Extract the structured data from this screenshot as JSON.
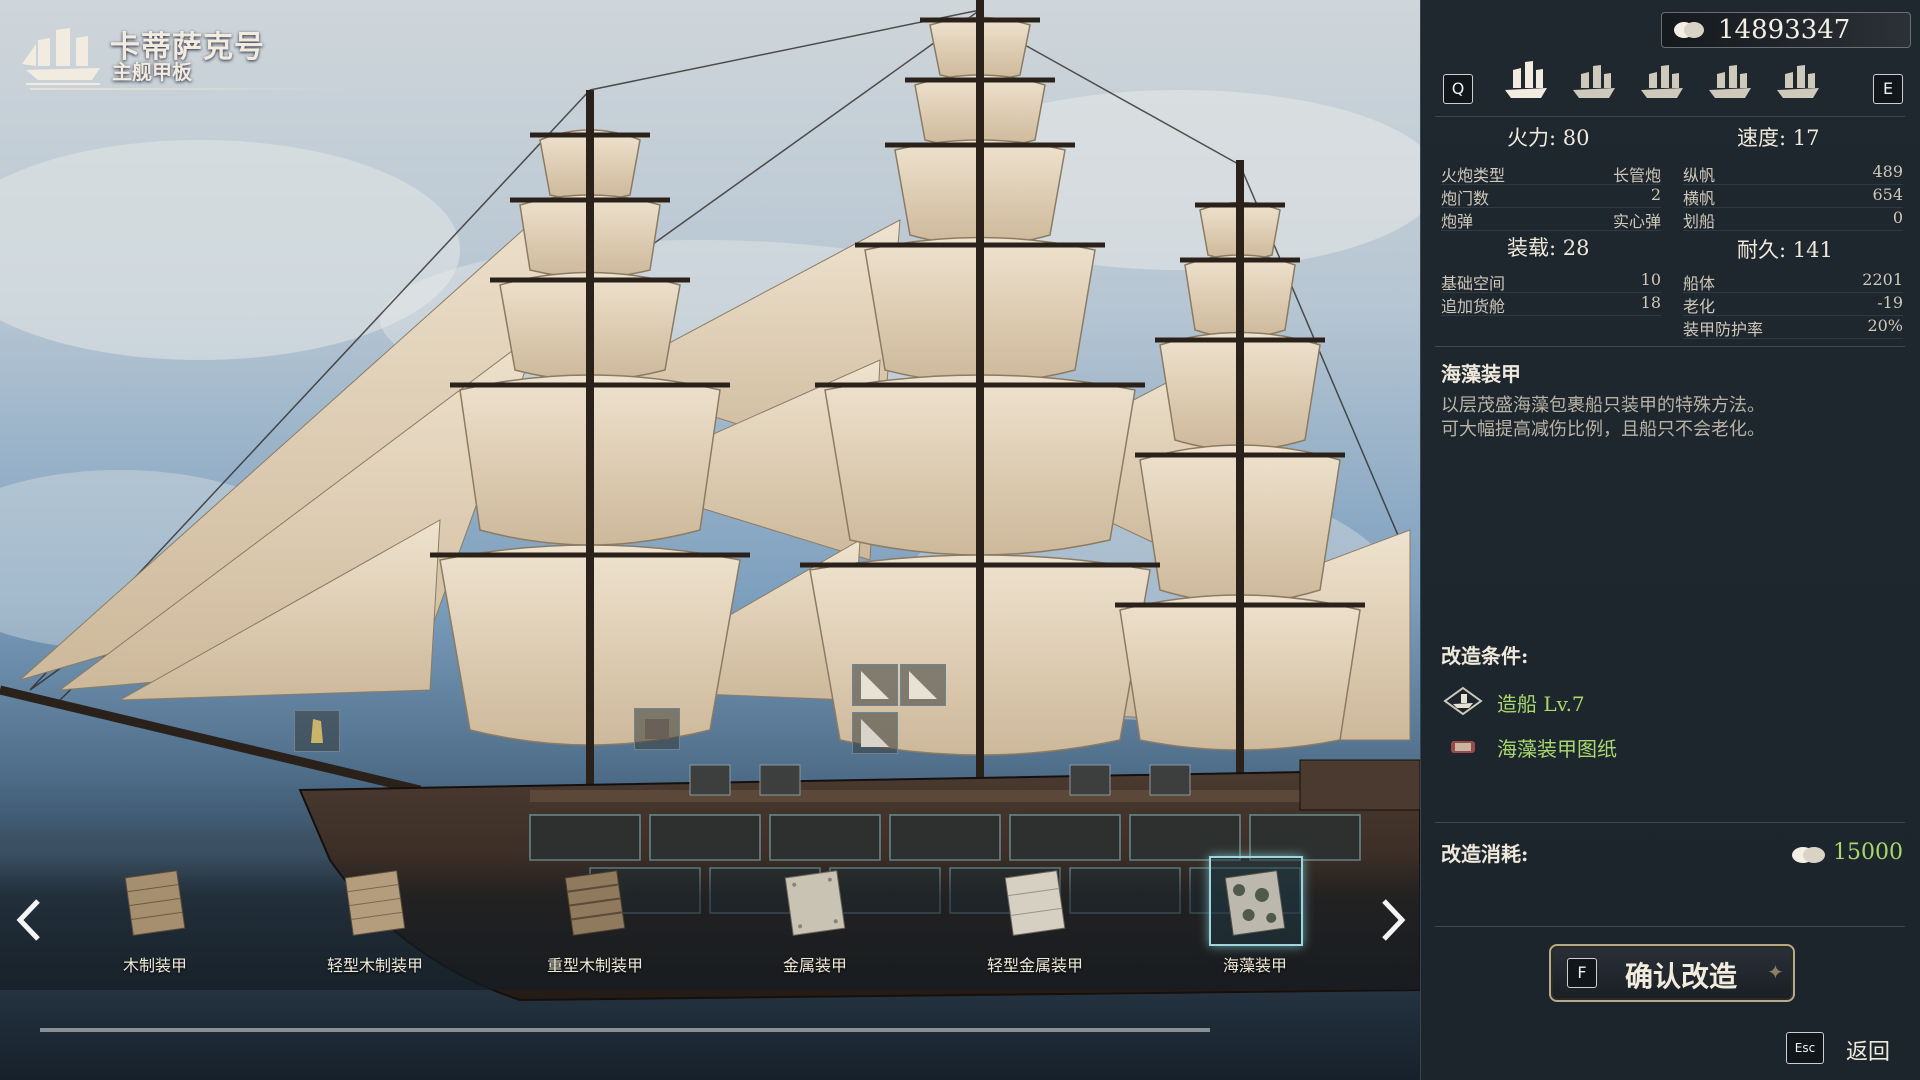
{
  "ship": {
    "name": "卡蒂萨克号",
    "deck": "主舰甲板"
  },
  "armor_options": [
    {
      "label": "木制装甲",
      "selected": false
    },
    {
      "label": "轻型木制装甲",
      "selected": false
    },
    {
      "label": "重型木制装甲",
      "selected": false
    },
    {
      "label": "金属装甲",
      "selected": false
    },
    {
      "label": "轻型金属装甲",
      "selected": false
    },
    {
      "label": "海藻装甲",
      "selected": true
    }
  ],
  "panel": {
    "gold": "14893347",
    "prev_key": "Q",
    "next_key": "E",
    "firepower": "火力: 80",
    "speed": "速度: 17",
    "cannon_stats": [
      {
        "k": "火炮类型",
        "v": "长管炮"
      },
      {
        "k": "炮门数",
        "v": "2"
      },
      {
        "k": "炮弹",
        "v": "实心弹"
      }
    ],
    "sail_stats": [
      {
        "k": "纵帆",
        "v": "489"
      },
      {
        "k": "横帆",
        "v": "654"
      },
      {
        "k": "划船",
        "v": "0"
      }
    ],
    "cargo": "装载: 28",
    "durability": "耐久: 141",
    "cargo_stats": [
      {
        "k": "基础空间",
        "v": "10"
      },
      {
        "k": "追加货舱",
        "v": "18"
      }
    ],
    "hull_stats": [
      {
        "k": "船体",
        "v": "2201"
      },
      {
        "k": "老化",
        "v": "-19"
      },
      {
        "k": "装甲防护率",
        "v": "20%"
      }
    ],
    "selected_title": "海藻装甲",
    "selected_desc_1": "以层茂盛海藻包裹船只装甲的特殊方法。",
    "selected_desc_2": "可大幅提高减伤比例，且船只不会老化。",
    "conditions_label": "改造条件:",
    "conditions": [
      {
        "text": "造船 Lv.7",
        "icon": "shipbuilding-icon"
      },
      {
        "text": "海藻装甲图纸",
        "icon": "blueprint-icon"
      }
    ],
    "cost_label": "改造消耗:",
    "cost_value": "15000",
    "confirm_key": "F",
    "confirm_label": "确认改造",
    "esc_key": "Esc",
    "back_label": "返回"
  }
}
